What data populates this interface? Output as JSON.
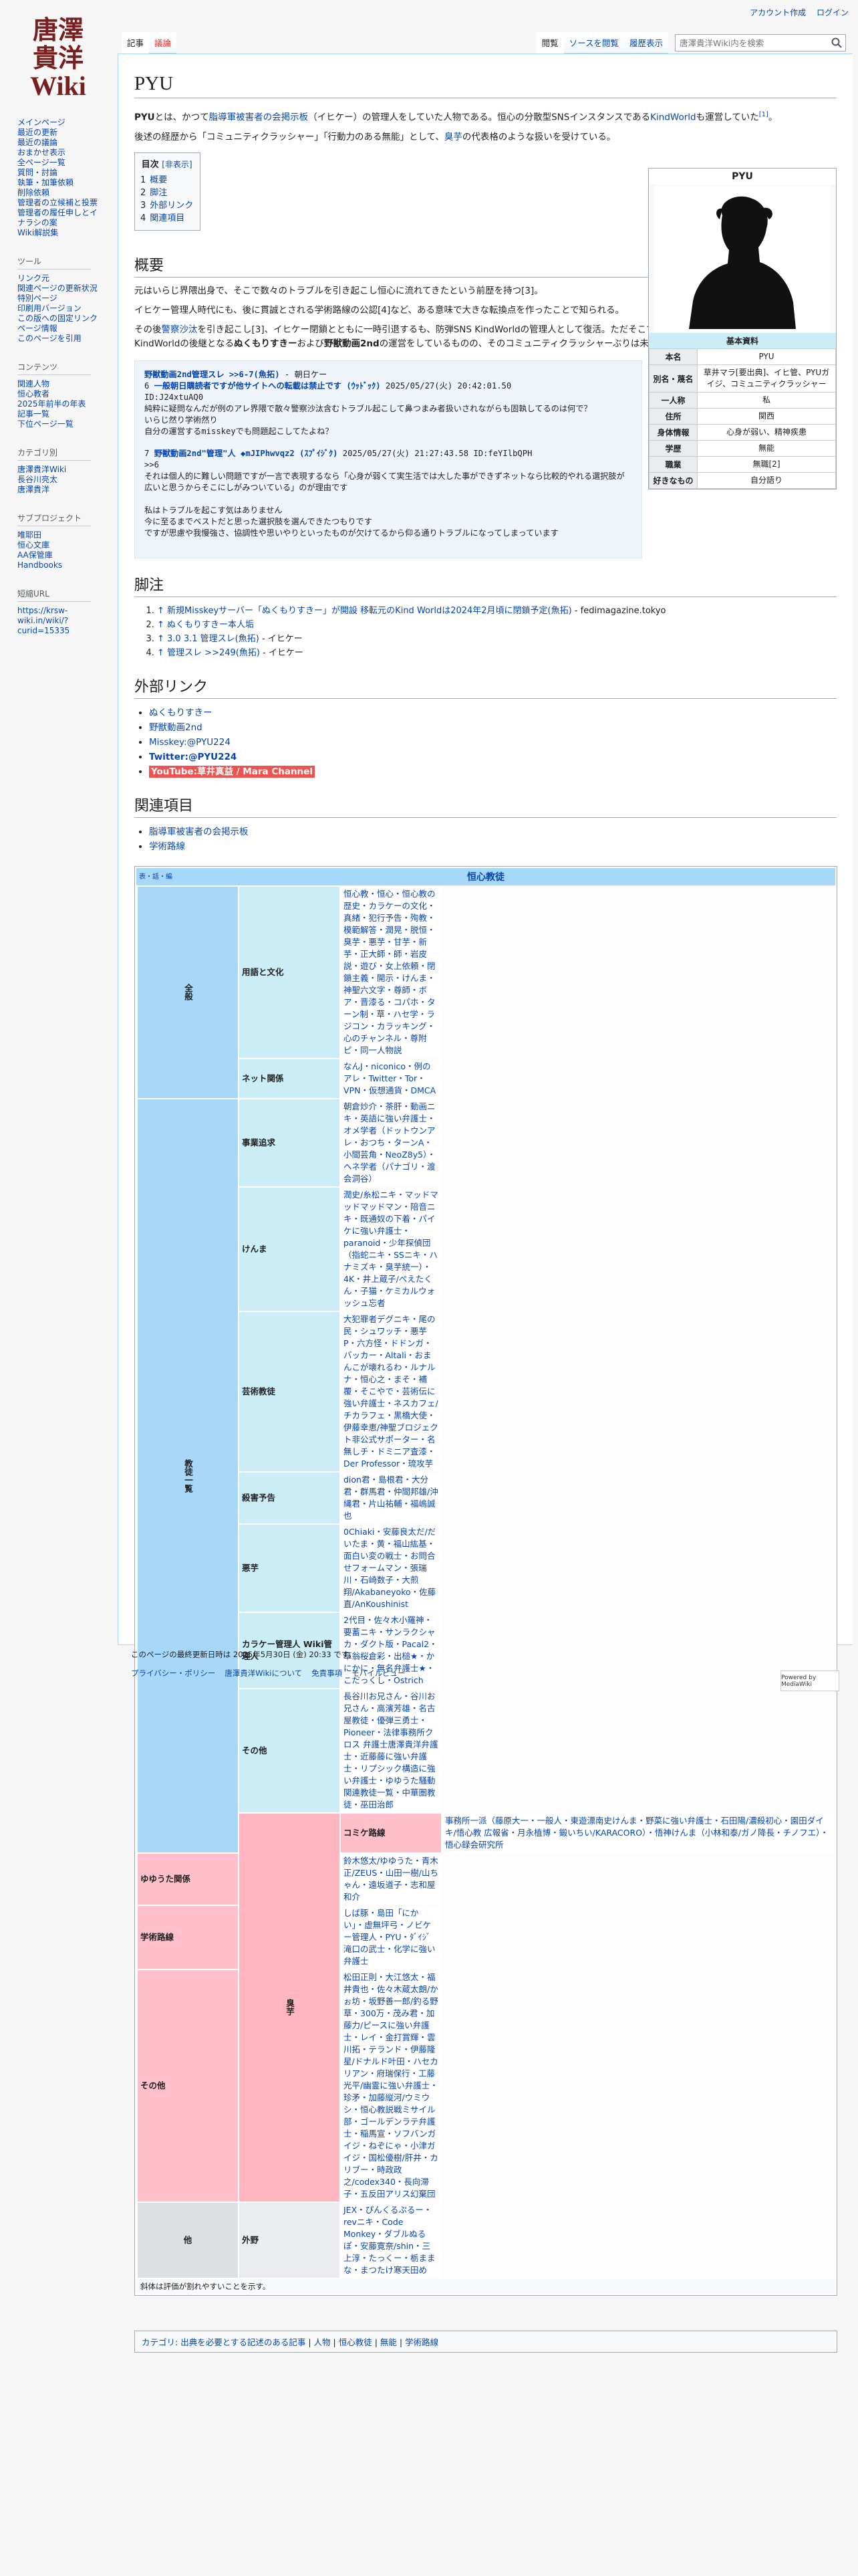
{
  "logo": {
    "line1": "唐澤",
    "line2": "貴洋",
    "line3": "Wiki"
  },
  "personal": [
    "アカウント作成",
    "ログイン"
  ],
  "tabs_left": [
    {
      "label": "記事",
      "selected": true,
      "red": false
    },
    {
      "label": "議論",
      "selected": false,
      "red": true
    }
  ],
  "tabs_right": [
    {
      "label": "閲覧",
      "selected": true
    },
    {
      "label": "ソースを閲覧",
      "selected": false
    },
    {
      "label": "履歴表示",
      "selected": false
    }
  ],
  "search": {
    "placeholder": "唐澤貴洋Wiki内を検索"
  },
  "sidebar": {
    "main": [
      "メインページ",
      "最近の更新",
      "最近の議論",
      "おまかせ表示",
      "全ページ一覧",
      "質問・討論",
      "執筆・加筆依頼",
      "削除依頼",
      "管理者の立候補と投票",
      "管理者の履任申しとイ",
      "ナラシの案",
      "Wiki解説集"
    ],
    "tools_heading": "ツール",
    "tools": [
      "リンク元",
      "関連ページの更新状況",
      "特別ページ",
      "印刷用バージョン",
      "この版への固定リンク",
      "ページ情報",
      "このページを引用"
    ],
    "content_heading": "コンテンツ",
    "content": [
      "関連人物",
      "恒心教者",
      "2025年前半の年表",
      "記事一覧",
      "下位ページ一覧"
    ],
    "cat_heading": "カテゴリ別",
    "cat": [
      "唐澤貴洋Wiki",
      "長谷川亮太",
      "唐澤貴洋"
    ],
    "sub_heading": "サブプロジェクト",
    "sub": [
      "唯耶田",
      "恒心文庫",
      "AA保管庫",
      "Handbooks"
    ],
    "url_heading": "短縮URL",
    "url": [
      "https://krsw-",
      "wiki.in/wiki/?",
      "curid=15335"
    ]
  },
  "title": "PYU",
  "intro": {
    "p1_a": "PYU",
    "p1_b": "とは、かつて",
    "p1_link1": "脂導軍被害者の会掲示板",
    "p1_c": "（イヒケー）の管理人をしていた人物である。恒心の分散型SNSインスタンスである",
    "p1_link2": "KindWorld",
    "p1_d": "も運営していた",
    "p1_ref": "[1]",
    "p1_e": "。",
    "p2_a": "後述の経歴から「コミュニティクラッシャー」「行動力のある無能」として、",
    "p2_link": "臭芋",
    "p2_b": "の代表格のような扱いを受けている。"
  },
  "toc": {
    "title": "目次",
    "hide": "[非表示]",
    "items": [
      {
        "num": "1",
        "label": "概要"
      },
      {
        "num": "2",
        "label": "脚注"
      },
      {
        "num": "3",
        "label": "外部リンク"
      },
      {
        "num": "4",
        "label": "関連項目"
      }
    ]
  },
  "infobox": {
    "title": "PYU",
    "head": "基本資料",
    "rows": [
      {
        "k": "本名",
        "v": "PYU"
      },
      {
        "k": "別名・蔑名",
        "v": "草井マラ[要出典]、イヒ管、PYUガイジ、コミュニティクラッシャー"
      },
      {
        "k": "一人称",
        "v": "私"
      },
      {
        "k": "住所",
        "v": "関西"
      },
      {
        "k": "身体情報",
        "v": "心身が弱い、精神疾患"
      },
      {
        "k": "学歴",
        "v": "無能"
      },
      {
        "k": "職業",
        "v": "無職[2]"
      },
      {
        "k": "好きなもの",
        "v": "自分語り"
      }
    ]
  },
  "sections": {
    "overview": "概要",
    "notes": "脚注",
    "external": "外部リンク",
    "related": "関連項目"
  },
  "overview": {
    "p1": "元はいらじ界隈出身で、そこで数々のトラブルを引き起こし恒心に流れてきたという前歴を持つ[3]。",
    "p2": "イヒケー管理人時代にも、後に貫誠とされる学術路線の公認[4]など、ある意味で大きな転換点を作ったことで知られる。",
    "p3_a": "その後",
    "p3_link": "警察沙汰",
    "p3_b": "を引き起こし[3]、イヒケー閉鎖とともに一時引退するも、防弾SNS KindWorldの管理人として復活。ただそこでもトラブルを起こしており、現在はKindWorldの後継となる",
    "p3_bold1": "ぬくもりすきー",
    "p3_c": "および",
    "p3_bold2": "野獣動画2nd",
    "p3_d": "の運営をしているものの、そのコミュニティクラッシャーぶりは未だ健在である。"
  },
  "quote": {
    "thread_title": "野獣動画2nd管理スレ >>6-7(魚拓)",
    "thread_suffix": " - 朝日ケー",
    "p1_num": "6",
    "p1_name": "一般朝日購読者ですが他サイトへの転載は禁止です (ｳｯﾄﾞｯｸ)",
    "p1_meta": " 2025/05/27(火) 20:42:01.50",
    "p1_id": "ID:J24xtuAQ0",
    "p1_lines": [
      "純粋に疑問なんだが例のアレ界隈で散々警察沙汰含むトラブル起こして鼻つまみ者扱いされながらも固執してるのは何で？",
      "いらじ然り学術然り",
      "自分の運営するmisskeyでも問題起こしてたよね？"
    ],
    "p2_num": "7",
    "p2_name": "野獣動画2nd\"管理\"人 ◆mJIPhwvqz2 (ｽﾌﾟｲｼﾞｸ)",
    "p2_meta": " 2025/05/27(火) 21:27:43.58 ID:feYIlbQPH",
    "p2_lines": [
      ">>6",
      "それは個人的に難しい問題ですが一言で表現するなら「心身が弱くて実生活では大した事ができずネットなら比較的やれる選択肢が広いと思うからそこにしがみついている」のが理由です",
      "",
      "私はトラブルを起こす気はありません",
      "今に至るまでベストだと思った選択肢を選んできたつもりです",
      "ですが思慮や我慢強さ、協調性や思いやりといったものが欠けてるから仰る通りトラブルになってしまっています"
    ]
  },
  "refs": [
    {
      "arrow": "↑",
      "link": "新規Misskeyサーバー「ぬくもりすきー」が開設 移転元のKind Worldは2024年2月頃に閉鎖予定(魚拓)",
      "rest": " - fedimagazine.tokyo"
    },
    {
      "arrow": "↑",
      "link": "ぬくもりすきー本人垢",
      "rest": ""
    },
    {
      "arrow": "↑ 3.0 3.1",
      "link": "管理スレ(魚拓)",
      "rest": " - イヒケー"
    },
    {
      "arrow": "↑",
      "link": "管理スレ >>249(魚拓)",
      "rest": " - イヒケー"
    }
  ],
  "external": [
    {
      "label": "ぬくもりすきー",
      "style": "link"
    },
    {
      "label": "野獣動画2nd",
      "style": "link"
    },
    {
      "label": "Misskey:@PYU224",
      "style": "link"
    },
    {
      "label": "Twitter:@PYU224",
      "style": "bold"
    },
    {
      "label": "YouTube:草井真益 / Mara Channel",
      "style": "yt"
    }
  ],
  "related": [
    "脂導軍被害者の会掲示板",
    "学術路線"
  ],
  "navbox": {
    "vde": "表・話・編",
    "title": "恒心教徒",
    "rows": [
      {
        "g1": "全般",
        "g2": "用語と文化",
        "items": "恒心教・恒心・恒心教の歴史・カラケーの文化・真緒・犯行予告・殉教・模範解答・潤晃・脱恒・臭芋・悪芋・甘芋・新芋・正大師・師・岩皮説・遊び・女上依頼・閉鎖主義・開示・けんま・神聖六文字・尊師・ボア・晋漆る・コパホ・ターン制・草・ハセ学・ラジコン・カラッキング・心のチャンネル・尊附ピ・同一人物説",
        "g1c": "g1",
        "g2c": "g2b",
        "g1span": 2
      },
      {
        "g2": "ネット関係",
        "items": "なんJ・niconico・例のアレ・Twitter・Tor・VPN・仮想通貨・DMCA",
        "g2c": "g2b"
      },
      {
        "g1": "教徒一覧",
        "g2": "事業追求",
        "items": "朝倉炒介・茶肝・動画ニキ・英語に強い弁護士・オメ学者（ドットウンアレ・おつち・ターンA・小間芸角・NeoZ8y5）・ヘネ学者（パナゴリ・渡会洞谷）",
        "g1c": "g1",
        "g2c": "g2b",
        "g1span": 8
      },
      {
        "g2": "けんま",
        "items": "潤史/糸松ニキ・マッドマッドマッドマン・陪音ニキ・既通奴の下着・パイケに強い弁護士・paranoid・少年探偵団（指蛇ニキ・SSニキ・ハナミズキ・臭芋統一）・4K・井上蔵子/ぺえたくん・子猫・ケミカルウォッシュ忘者",
        "g2c": "g2b"
      },
      {
        "g2": "芸術教徒",
        "items": "大犯罪者デグニキ・尾の民・シュワッチ・悪芋P・六方怪・ドドンガ・バッカー・Altali・おまんこが壊れるわ・ルナルナ・恒心之・まそ・補覆・そこやで・芸術伝に強い弁護士・ネスカフェ/チカラフェ・黒橋大使・伊藤幸恵/神聖ブロジェクト非公式サポーター・名無しチ・ドミニア査漆・Der Professor・琉攻芋",
        "g2c": "g2b"
      },
      {
        "g2": "殺害予告",
        "items": "dion君・島根君・大分君・群馬君・仲間邦雄/沖縄君・片山祐輔・福嶋誠也",
        "g2c": "g2b"
      },
      {
        "g2": "悪芋",
        "items": "0Chiaki・安藤良太だ/だいたま・黄・福山紘基・面白い変の戦士・お問合せフォームマン・張瑞川・石崎数子・大煎翔/Akabaneyoko・佐藤直/AnKoushinist",
        "g2c": "g2b"
      },
      {
        "g2": "カラケー管理人 Wiki管理人",
        "items": "2代目・佐々木小羅神・要蓄ニキ・サンラクシャカ・ダクト版・Pacal2・草翁桜倉彩・出槌★・かにかに・無名弁護士★・こだっくし・Ostrich",
        "g2c": "g2b"
      },
      {
        "g2": "その他",
        "items": "長谷川お兄さん・谷川お兄さん・高濱芳雄・名古屋教徒・優弾三勇士・Pioneer・法律事務所クロス 弁護士唐澤貴洋弁護士・近藤藤に強い弁護士・リプシック構造に強い弁護士・ゆゆうた騒動関連教徒一覧・中華圏教徒・巫田治郎",
        "g2c": "g2b"
      },
      {
        "g1": "臭芋",
        "g2": "コミケ路線",
        "items": "事務所一派（藤原大一・一般人・東遊漂南史けんま・野菜に強い弁護士・石田陽/濃殺初心・園田ダイキ/悟心教 広報省・月永植博・鍛いちい/KARACORO）・悟神けんま（小林和泰/ガノ降長・チノフエ）・悟心録会研究所",
        "g1c": "gp1",
        "g2c": "gp2",
        "g1span": 4
      },
      {
        "g2": "ゆゆうた関係",
        "items": "鈴木悠太/ゆゆうた・青木正/ZEUS・山田一樹/山ちゃん・遠坂道子・志和屋和介",
        "g2c": "gp2"
      },
      {
        "g2": "学術路線",
        "items": "しば豚・島田「にかい」・虚無坪弓・ノビケー管理人・PYU・ﾀﾞｲｼﾞ滝口の武士・化学に強い弁護士",
        "g2c": "gp2"
      },
      {
        "g2": "その他",
        "items": "松田正則・大江悠太・福井貴也・佐々木蔵太朗/かぉ坊・坂野善一郎/釣る野草・300万・茂み君・加藤力/ピースに強い弁護士・レイ・金打賞輝・雲川拓・テランド・伊藤隆星/ドナルド叶田・ハセカリアン・府瑞保行・工藤光平/幽霊に強い弁護士・珍矛・加藤縦河/ウミウシ・恒心教説戦ミサイル部・ゴールデンラテ弁護士・稲馬宣・ソフバンガイジ・ねぞにゃ・小津ガイジ・国松優樹/肝井・カリブー・時政政之/codex340・長向滞子・五反田アリス幻棄団",
        "g2c": "gp2"
      },
      {
        "g1": "他",
        "g2": "外野",
        "items": "JEX・ぴんくるぷるー・revニキ・Code Monkey・ダブルぬるぽ・安藤寛奈/shin・三上淳・たっくー・栃ままな・まつたけ寒天田め",
        "g1c": "gray1",
        "g2c": "gray2",
        "g1span": 1
      }
    ],
    "note": "斜体は評価が割れやすいことを示す。"
  },
  "categories": {
    "label": "カテゴリ",
    "items": [
      "出典を必要とする記述のある記事",
      "人物",
      "恒心教徒",
      "無能",
      "学術路線"
    ]
  },
  "footer": {
    "last": "このページの最終更新日時は 2025年5月30日 (金) 20:33 です。",
    "links": [
      "プライバシー・ポリシー",
      "唐澤貴洋Wikiについて",
      "免責事項",
      "モバイルビュー"
    ],
    "powered": "Powered by MediaWiki"
  }
}
